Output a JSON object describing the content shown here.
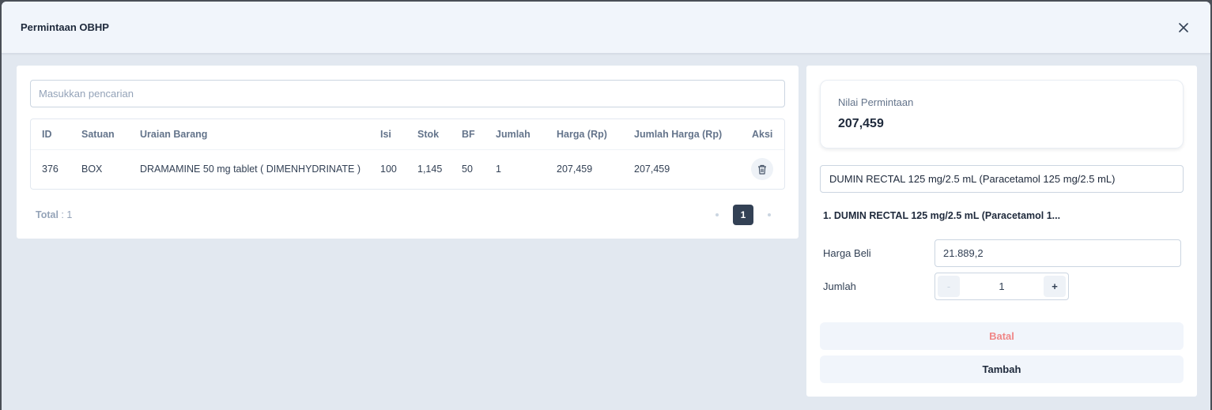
{
  "modal": {
    "title": "Permintaan OBHP"
  },
  "search": {
    "placeholder": "Masukkan pencarian"
  },
  "table": {
    "headers": {
      "id": "ID",
      "satuan": "Satuan",
      "uraian": "Uraian Barang",
      "isi": "Isi",
      "stok": "Stok",
      "bf": "BF",
      "jumlah": "Jumlah",
      "harga": "Harga (Rp)",
      "jumlah_harga": "Jumlah Harga (Rp)",
      "aksi": "Aksi"
    },
    "rows": [
      {
        "id": "376",
        "satuan": "BOX",
        "uraian": "DRAMAMINE 50 mg tablet ( DIMENHYDRINATE )",
        "isi": "100",
        "stok": "1,145",
        "bf": "50",
        "jumlah": "1",
        "harga": "207,459",
        "jumlah_harga": "207,459"
      }
    ]
  },
  "footer": {
    "total_label": "Total",
    "total_value": ": 1",
    "current_page": "1"
  },
  "summary": {
    "nilai_label": "Nilai Permintaan",
    "nilai_value": "207,459"
  },
  "form": {
    "selected_item": "DUMIN RECTAL 125 mg/2.5 mL (Paracetamol 125 mg/2.5 mL)",
    "item_title": "1.  DUMIN RECTAL 125 mg/2.5 mL (Paracetamol 1...",
    "harga_beli_label": "Harga Beli",
    "harga_beli_value": "21.889,2",
    "jumlah_label": "Jumlah",
    "jumlah_value": "1",
    "minus": "-",
    "plus": "+",
    "batal_label": "Batal",
    "tambah_label": "Tambah"
  },
  "icons": {
    "close": "close-icon",
    "trash": "trash-icon",
    "prev": "chevron-left-icon",
    "next": "chevron-right-icon"
  },
  "colors": {
    "active_page": "#334155",
    "cancel_text": "#f08787",
    "header_bg": "#f1f5fb"
  }
}
